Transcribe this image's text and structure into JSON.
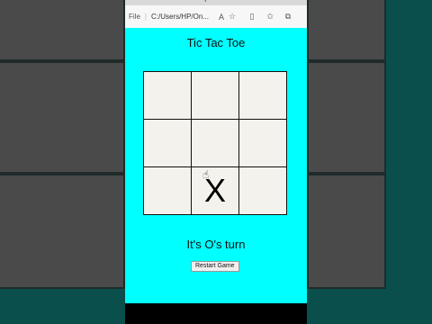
{
  "browser": {
    "new_tab_icon": "plus-icon",
    "file_label": "File",
    "url": "C:/Users/HP/On...",
    "icons": [
      "read-aloud-icon",
      "favorite-star-icon",
      "split-screen-icon",
      "favorites-icon",
      "collections-icon"
    ]
  },
  "game": {
    "title": "Tic Tac Toe",
    "cells": [
      "",
      "",
      "",
      "",
      "",
      "",
      "",
      "X",
      ""
    ],
    "status": "It's O's turn",
    "restart_label": "Restart Game"
  },
  "colors": {
    "page_background": "#00ffff",
    "backdrop": "#0a4f4c"
  }
}
